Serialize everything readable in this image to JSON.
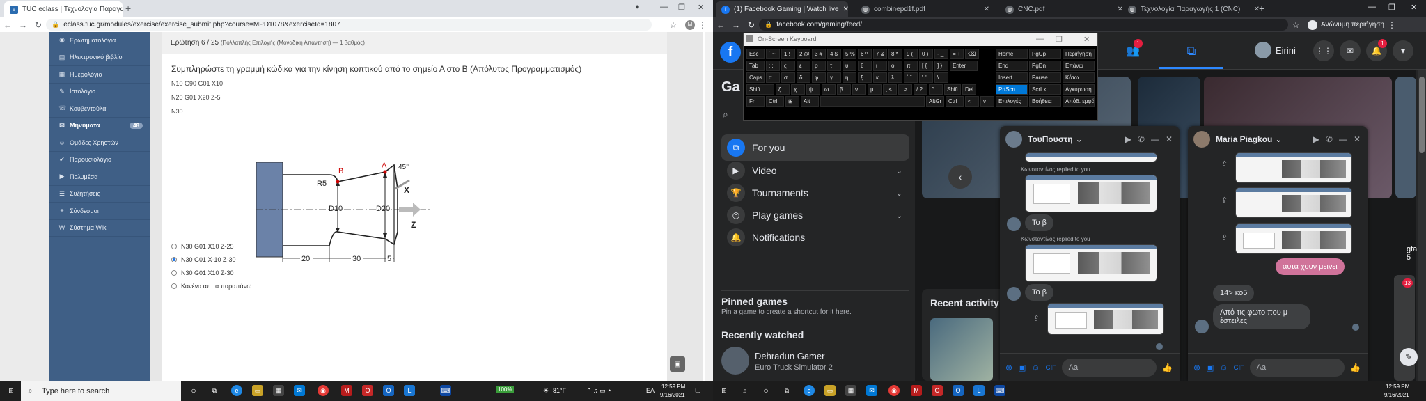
{
  "left_browser": {
    "tabs": [
      {
        "title": "TUC eclass | Τεχνολογία Παραγω...",
        "active": true
      }
    ],
    "url": "eclass.tuc.gr/modules/exercise/exercise_submit.php?course=MPD1078&exerciseId=1807",
    "profile_initial": "M"
  },
  "lms": {
    "menu": [
      {
        "label": "Ερωτηματολόγια",
        "icon": "poll-icon"
      },
      {
        "label": "Ηλεκτρονικό βιβλίο",
        "icon": "book-icon"
      },
      {
        "label": "Ημερολόγιο",
        "icon": "calendar-icon"
      },
      {
        "label": "Ιστολόγιο",
        "icon": "blog-icon"
      },
      {
        "label": "Κουβεντούλα",
        "icon": "chat-icon"
      },
      {
        "label": "Μηνύματα",
        "icon": "mail-icon",
        "bold": true,
        "count": "48"
      },
      {
        "label": "Ομάδες Χρηστών",
        "icon": "users-icon"
      },
      {
        "label": "Παρουσιολόγιο",
        "icon": "attendance-icon"
      },
      {
        "label": "Πολυμέσα",
        "icon": "media-icon"
      },
      {
        "label": "Συζητήσεις",
        "icon": "forum-icon"
      },
      {
        "label": "Σύνδεσμοι",
        "icon": "link-icon"
      },
      {
        "label": "Σύστημα Wiki",
        "icon": "wiki-icon"
      }
    ],
    "question_header": "Ερώτηση 6 / 25",
    "question_meta": "(Πολλαπλής Επιλογής (Μοναδική Απάντηση) — 1 βαθμός)",
    "question_text": "Συμπληρώστε τη γραμμή κώδικα για την κίνηση κοπτικού από το σημείο Α στο Β (Απόλυτος Προγραμματισμός)",
    "code_lines": [
      "N10 G90 G01 X10",
      "N20 G01 X20 Z-5",
      "N30 ......"
    ],
    "diagram": {
      "label_A": "A",
      "label_B": "B",
      "angle": "45°",
      "radius": "R5",
      "d_small": "D10",
      "d_large": "D20",
      "axis_x": "X",
      "axis_z": "Z",
      "dim_1": "20",
      "dim_2": "30",
      "dim_3": "5"
    },
    "options": [
      {
        "label": "N30 G01 X10 Z-25",
        "checked": false
      },
      {
        "label": "N30 G01 X-10 Z-30",
        "checked": true
      },
      {
        "label": "N30 G01 X10 Z-30",
        "checked": false
      },
      {
        "label": "Κανένα απ τα παραπάνω",
        "checked": false
      }
    ]
  },
  "right_browser": {
    "tabs": [
      {
        "title": "(1) Facebook Gaming | Watch live",
        "active": true
      },
      {
        "title": "combinepd1f.pdf",
        "active": false
      },
      {
        "title": "CNC.pdf",
        "active": false
      },
      {
        "title": "Τεχνολογία Παραγωγής 1 (CNC)",
        "active": false
      }
    ],
    "url": "facebook.com/gaming/feed/",
    "profile_label": "Ανώνυμη περιήγηση"
  },
  "facebook": {
    "user_name": "Eirini",
    "friends_badge": "1",
    "notif_badge": "1",
    "page_title_partial": "Ga",
    "nav": [
      {
        "label": "For you",
        "icon": "gaming-icon",
        "active": true
      },
      {
        "label": "Video",
        "icon": "play-icon",
        "expand": true
      },
      {
        "label": "Tournaments",
        "icon": "trophy-icon",
        "expand": true
      },
      {
        "label": "Play games",
        "icon": "gamepad-icon",
        "expand": true
      },
      {
        "label": "Notifications",
        "icon": "bell-icon"
      }
    ],
    "pinned_title": "Pinned games",
    "pinned_hint": "Pin a game to create a shortcut for it here.",
    "recent_title": "Recently watched",
    "recent_item": {
      "name": "Dehradun Gamer",
      "game": "Euro Truck Simulator 2"
    },
    "recent_activity": "Recent activity",
    "tile_partial": "gta 5",
    "tile_badge": "13"
  },
  "chat1": {
    "name": "ΤουΠουστη",
    "reply_note": "Κωνσταντίνος replied to you",
    "reply_bubble": "Το β",
    "input_placeholder": "Aa"
  },
  "chat2": {
    "name": "Maria Piagkou",
    "my_message": "αυτα χουν μεινει",
    "msg1": "14> κο5",
    "msg2": "Από τις φωτο που μ έστειλες",
    "input_placeholder": "Aa"
  },
  "osk": {
    "title": "On-Screen Keyboard",
    "rows": [
      [
        "Esc",
        "` ~",
        "1 !",
        "2 @",
        "3 #",
        "4 $",
        "5 %",
        "6 ^",
        "7 &",
        "8 *",
        "9 (",
        "0 )",
        "- _",
        "= +",
        "⌫"
      ],
      [
        "Tab",
        "; :",
        "ς",
        "ε",
        "ρ",
        "τ",
        "υ",
        "θ",
        "ι",
        "ο",
        "π",
        "[ {",
        "] }",
        "Enter"
      ],
      [
        "Caps",
        "α",
        "σ",
        "δ",
        "φ",
        "γ",
        "η",
        "ξ",
        "κ",
        "λ",
        "΄ ¨",
        "' \"",
        "\\ |"
      ],
      [
        "Shift",
        "ζ",
        "χ",
        "ψ",
        "ω",
        "β",
        "ν",
        "μ",
        ", <",
        ". >",
        "/ ?",
        "^",
        "Shift",
        "Del"
      ],
      [
        "Fn",
        "Ctrl",
        "⊞",
        "Alt",
        "",
        "AltGr",
        "Ctrl",
        "<",
        "v",
        ">",
        "⌨"
      ]
    ],
    "side": [
      [
        "Home",
        "PgUp",
        "Περιήγηση"
      ],
      [
        "End",
        "PgDn",
        "Επάνω"
      ],
      [
        "Insert",
        "Pause",
        "Κάτω"
      ],
      [
        "PrtScn",
        "ScrLk",
        "Αγκύρωση"
      ],
      [
        "Επιλογές",
        "Βοήθεια",
        "Απόδ. εμφάνισης"
      ]
    ]
  },
  "taskbar_left": {
    "search": "Type here to search",
    "battery": "100%",
    "weather": "81°F",
    "lang": "ΕΛ",
    "time": "12:59 PM",
    "date": "9/16/2021"
  },
  "taskbar_right": {
    "time": "12:59 PM",
    "date": "9/16/2021"
  }
}
